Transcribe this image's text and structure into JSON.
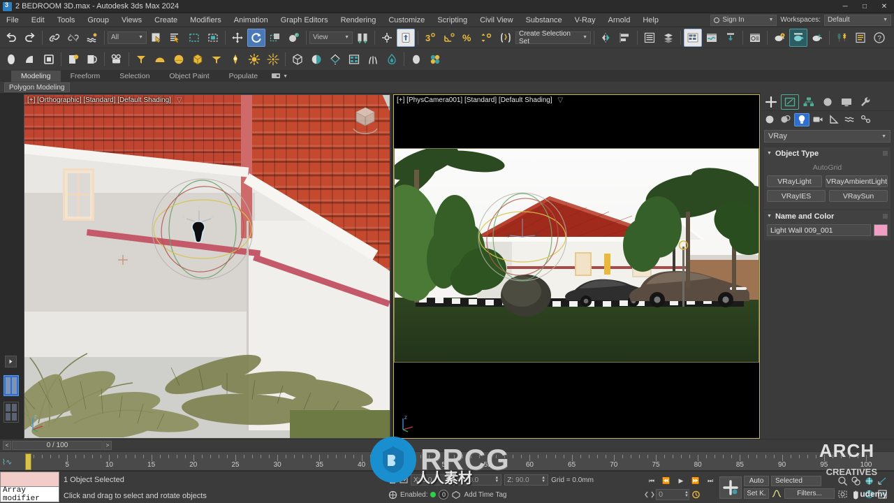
{
  "window": {
    "title": "2 BEDROOM 3D.max - Autodesk 3ds Max 2024",
    "app_icon": "3dsmax-icon",
    "minimize": "─",
    "maximize": "□",
    "close": "✕"
  },
  "menu": {
    "items": [
      "File",
      "Edit",
      "Tools",
      "Group",
      "Views",
      "Create",
      "Modifiers",
      "Animation",
      "Graph Editors",
      "Rendering",
      "Customize",
      "Scripting",
      "Civil View",
      "Substance",
      "V-Ray",
      "Arnold",
      "Help"
    ],
    "sign_in": "Sign In",
    "workspaces_label": "Workspaces:",
    "workspace_value": "Default"
  },
  "toolbar": {
    "selection_filter": "All",
    "reference_coord_system": "View",
    "selection_set": "Create Selection Set",
    "buttons": [
      {
        "name": "undo-button",
        "icon": "undo-icon"
      },
      {
        "name": "redo-button",
        "icon": "redo-icon"
      },
      {
        "name": "select-link-button",
        "icon": "link-icon"
      },
      {
        "name": "unlink-button",
        "icon": "unlink-icon"
      },
      {
        "name": "bind-space-warp-button",
        "icon": "space-warp-icon"
      },
      {
        "name": "select-object-button",
        "icon": "select-arrow-icon"
      },
      {
        "name": "select-by-name-button",
        "icon": "select-name-icon"
      },
      {
        "name": "rect-select-region-button",
        "icon": "rectangle-select-icon"
      },
      {
        "name": "window-crossing-button",
        "icon": "window-crossing-icon"
      },
      {
        "name": "select-move-button",
        "icon": "move-icon"
      },
      {
        "name": "select-rotate-button",
        "icon": "rotate-icon",
        "active": true
      },
      {
        "name": "select-scale-button",
        "icon": "scale-icon"
      },
      {
        "name": "placement-button",
        "icon": "placement-icon"
      },
      {
        "name": "use-center-button",
        "icon": "pivot-center-icon"
      },
      {
        "name": "select-and-manipulate-button",
        "icon": "manipulate-icon"
      },
      {
        "name": "snaps-toggle-button",
        "icon": "snap-3-icon"
      },
      {
        "name": "angle-snap-button",
        "icon": "angle-snap-icon"
      },
      {
        "name": "percent-snap-button",
        "icon": "percent-snap-icon"
      },
      {
        "name": "spinner-snap-button",
        "icon": "spinner-snap-icon"
      },
      {
        "name": "edit-named-selection-button",
        "icon": "named-selection-icon"
      },
      {
        "name": "mirror-button",
        "icon": "mirror-icon"
      },
      {
        "name": "align-button",
        "icon": "align-icon"
      },
      {
        "name": "layer-explorer-button",
        "icon": "layers-icon"
      },
      {
        "name": "scene-explorer-button",
        "icon": "scene-explorer-icon"
      },
      {
        "name": "curve-editor-button",
        "icon": "curve-editor-icon"
      },
      {
        "name": "schematic-view-button",
        "icon": "schematic-icon"
      },
      {
        "name": "render-setup-button",
        "icon": "render-setup-icon"
      },
      {
        "name": "material-editor-button",
        "icon": "teapot-gear-icon"
      },
      {
        "name": "render-frame-button",
        "icon": "teapot-render-icon",
        "active": true
      },
      {
        "name": "render-production-button",
        "icon": "teapot-lightning-icon"
      },
      {
        "name": "project-folder-button",
        "icon": "trees-icon"
      },
      {
        "name": "script-listener-button",
        "icon": "script-icon"
      },
      {
        "name": "help-button",
        "icon": "question-icon"
      }
    ],
    "create_row": [
      {
        "name": "create-primitive-button",
        "icon": "object-icon"
      },
      {
        "name": "create-shape-button",
        "icon": "arc-icon"
      },
      {
        "name": "create-box-button",
        "icon": "box-icon"
      },
      {
        "name": "light-create-button",
        "icon": "bulb-icon"
      },
      {
        "name": "helper-create-button",
        "icon": "helper-icon"
      },
      {
        "name": "camera-create-button",
        "icon": "camera-icon"
      },
      {
        "name": "vray-light-button",
        "icon": "vray-light-icon"
      },
      {
        "name": "vray-dome-button",
        "icon": "vray-dome-icon"
      },
      {
        "name": "vray-sphere-button",
        "icon": "vray-sphere-icon"
      },
      {
        "name": "vray-ies-button",
        "icon": "vray-ies-icon"
      },
      {
        "name": "vray-plane-button",
        "icon": "vray-plane-icon"
      },
      {
        "name": "vray-sun-button",
        "icon": "vray-sun-icon"
      },
      {
        "name": "daylight-button",
        "icon": "sun-icon"
      },
      {
        "name": "omni-light-button",
        "icon": "omni-icon"
      },
      {
        "name": "vray-proxy-button",
        "icon": "proxy-icon"
      },
      {
        "name": "vray-fur-button",
        "icon": "fur-icon"
      },
      {
        "name": "vray-clipper-button",
        "icon": "clipper-icon"
      },
      {
        "name": "vray-displacement-button",
        "icon": "displace-icon"
      },
      {
        "name": "vray-grass-button",
        "icon": "grass-icon"
      },
      {
        "name": "vray-ggx-button",
        "icon": "flame-icon"
      },
      {
        "name": "vray-mesh-button",
        "icon": "sphere-icon"
      },
      {
        "name": "vray-atmos-button",
        "icon": "dots-icon"
      }
    ]
  },
  "ribbon": {
    "tabs": [
      {
        "label": "Modeling",
        "active": true
      },
      {
        "label": "Freeform",
        "active": false
      },
      {
        "label": "Selection",
        "active": false
      },
      {
        "label": "Object Paint",
        "active": false
      },
      {
        "label": "Populate",
        "active": false
      }
    ],
    "subtitle": "Polygon Modeling"
  },
  "viewports": [
    {
      "name": "viewport-left",
      "label": "[+] [Orthographic] [Standard] [Default Shading]",
      "active": false,
      "scene": "close-up of tiled roof corner, white stucco wall with pink trim, palm fronds, rotate gizmo on selected light"
    },
    {
      "name": "viewport-right",
      "label": "[+] [PhysCamera001] [Standard] [Default Shading]",
      "active": true,
      "scene": "camera render of white single-story house with red roof, two parked cars, palm trees, green lawn"
    }
  ],
  "command_panel": {
    "tabs": [
      {
        "name": "create-tab",
        "icon": "plus-icon",
        "selected": false
      },
      {
        "name": "modify-tab",
        "icon": "modify-icon",
        "selected": true
      },
      {
        "name": "hierarchy-tab",
        "icon": "hierarchy-icon",
        "selected": false
      },
      {
        "name": "motion-tab",
        "icon": "motion-icon",
        "selected": false
      },
      {
        "name": "display-tab",
        "icon": "display-icon",
        "selected": false
      },
      {
        "name": "utilities-tab",
        "icon": "wrench-icon",
        "selected": false
      }
    ],
    "subtabs": [
      {
        "name": "geometry-subtab",
        "icon": "sphere-icon",
        "selected": false
      },
      {
        "name": "shapes-subtab",
        "icon": "shapes-icon",
        "selected": false
      },
      {
        "name": "lights-subtab",
        "icon": "bulb-icon",
        "selected": true
      },
      {
        "name": "cameras-subtab",
        "icon": "camera-icon",
        "selected": false
      },
      {
        "name": "helpers-subtab",
        "icon": "triangle-icon",
        "selected": false
      },
      {
        "name": "space-warps-subtab",
        "icon": "waves-icon",
        "selected": false
      },
      {
        "name": "systems-subtab",
        "icon": "systems-icon",
        "selected": false
      }
    ],
    "category": "VRay",
    "object_type": {
      "title": "Object Type",
      "autogrid": "AutoGrid",
      "buttons": [
        "VRayLight",
        "VRayAmbientLight",
        "VRayIES",
        "VRaySun"
      ]
    },
    "name_and_color": {
      "title": "Name and Color",
      "name": "Light Wall 009_001",
      "color": "#f09ec2"
    }
  },
  "timeline": {
    "frame_display": "0 / 100",
    "prev_label": "<",
    "next_label": ">",
    "range_start": 0,
    "range_end": 100,
    "major_ticks": [
      0,
      5,
      10,
      15,
      20,
      25,
      30,
      35,
      40,
      45,
      50,
      55,
      60,
      65,
      70,
      75,
      80,
      85,
      90,
      95,
      100
    ],
    "current_frame": 0
  },
  "status": {
    "modifier_tooltip": "Array modifier",
    "modifier_color": "#f2ccc8",
    "selection_text": "1 Object Selected",
    "prompt_text": "Click and drag to select and rotate objects",
    "coords": [
      {
        "label": "X:",
        "value": "0.0"
      },
      {
        "label": "Y:",
        "value": "0.0"
      },
      {
        "label": "Z:",
        "value": "90.0"
      }
    ],
    "grid": "Grid = 0.0mm",
    "enabled_label": "Enabled:",
    "enabled_value": "0",
    "add_time_tag": "Add Time Tag",
    "key_frame_value": "0",
    "auto_key": "Auto",
    "set_key": "Set K.",
    "selected_filter": "Selected",
    "filters": "Filters...",
    "playback": [
      "⏮",
      "⏪",
      "▶",
      "⏩",
      "⏭"
    ]
  },
  "watermarks": {
    "rrcg": "RRCG",
    "chinese": "人人素材",
    "arch": "ARCH",
    "creatives": "CREATIVES",
    "udemy": "udemy"
  }
}
